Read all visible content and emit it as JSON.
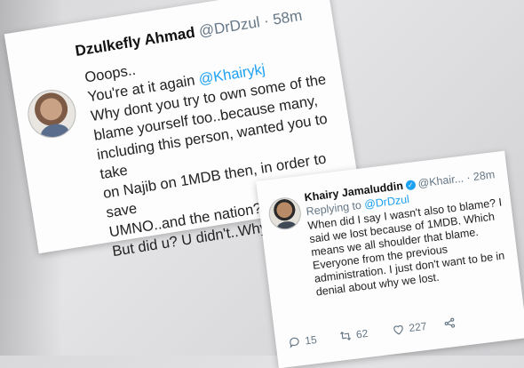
{
  "tweet1": {
    "name": "Dzulkefly Ahmad",
    "handle": "@DrDzul",
    "time": "· 58m",
    "lines": [
      "Ooops..",
      "You're at it again ",
      "Why dont you try to own some of the",
      "blame yourself too..because many,",
      "including this person, wanted you to take",
      "on Najib on 1MDB then, in order to save",
      "UMNO..and the nation?",
      "But did u? U didn't..Why?"
    ],
    "mention": "@Khairykj"
  },
  "tweet2": {
    "name": "Khairy Jamaluddin",
    "handle": "@Khair...",
    "time": "· 28m",
    "replying_prefix": "Replying to ",
    "replying_to": "@DrDzul",
    "lines": [
      "When did I say I wasn't also to blame? I",
      "said we lost because of 1MDB. Which",
      "means we all shoulder that blame.",
      "Everyone from the previous",
      "administration. I just don't want to be in",
      "denial about why we lost."
    ],
    "actions": {
      "replies": "15",
      "retweets": "62",
      "likes": "227"
    }
  }
}
